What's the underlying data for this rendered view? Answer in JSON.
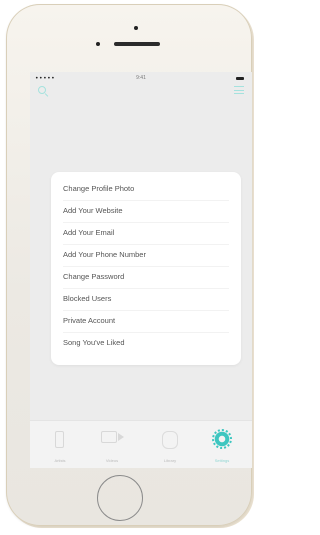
{
  "status_bar": {
    "signal": "•••••",
    "time": "9:41"
  },
  "header": {
    "search_icon": "search-icon",
    "menu_icon": "hamburger-icon"
  },
  "settings_menu": {
    "items": [
      {
        "label": "Change Profile Photo"
      },
      {
        "label": "Add Your Website"
      },
      {
        "label": "Add Your Email"
      },
      {
        "label": "Add Your Phone Number"
      },
      {
        "label": "Change Password"
      },
      {
        "label": "Blocked Users"
      },
      {
        "label": "Private Account"
      },
      {
        "label": "Song You've Liked"
      }
    ]
  },
  "tab_bar": {
    "tabs": [
      {
        "label": "Artists",
        "icon": "music-icon"
      },
      {
        "label": "Videos",
        "icon": "video-icon"
      },
      {
        "label": "Library",
        "icon": "library-icon"
      },
      {
        "label": "Settings",
        "icon": "gear-icon",
        "active": true
      }
    ]
  },
  "colors": {
    "accent": "#3ec6c0",
    "accent_light": "#a5e2de",
    "card": "#ffffff",
    "screen_bg": "#ececec"
  }
}
